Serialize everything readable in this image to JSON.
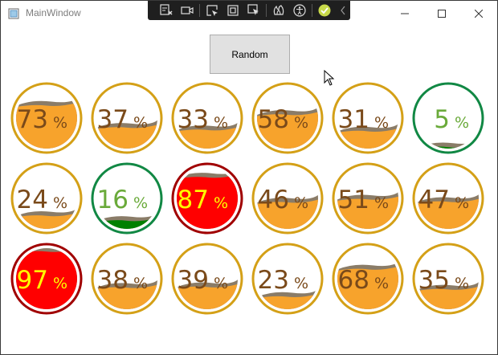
{
  "window": {
    "title": "MainWindow"
  },
  "toolbar": {
    "icons": [
      "live-visual-tree-icon",
      "record-icon",
      "select-element-icon",
      "display-layout-adorners-icon",
      "track-focus-icon",
      "hot-reload-icon",
      "accessibility-icon",
      "check-icon",
      "collapse-chevron-icon"
    ]
  },
  "controls": {
    "random_label": "Random"
  },
  "colors": {
    "normal_ring": "#d4a017",
    "normal_fill": "#f7a32c",
    "normal_text": "#7a4a1a",
    "low_ring": "#118844",
    "low_fill": "#008000",
    "low_text": "#6aaa3a",
    "high_ring": "#a00000",
    "high_fill": "#ff0000",
    "high_text": "#ffff00",
    "wave_shadow": "#8a7c68"
  },
  "gauges": [
    {
      "value": 73,
      "unit": "%",
      "state": "normal"
    },
    {
      "value": 37,
      "unit": "%",
      "state": "normal"
    },
    {
      "value": 33,
      "unit": "%",
      "state": "normal"
    },
    {
      "value": 58,
      "unit": "%",
      "state": "normal"
    },
    {
      "value": 31,
      "unit": "%",
      "state": "normal"
    },
    {
      "value": 5,
      "unit": "%",
      "state": "low"
    },
    {
      "value": 24,
      "unit": "%",
      "state": "normal"
    },
    {
      "value": 16,
      "unit": "%",
      "state": "low"
    },
    {
      "value": 87,
      "unit": "%",
      "state": "high"
    },
    {
      "value": 46,
      "unit": "%",
      "state": "normal"
    },
    {
      "value": 51,
      "unit": "%",
      "state": "normal"
    },
    {
      "value": 47,
      "unit": "%",
      "state": "normal"
    },
    {
      "value": 97,
      "unit": "%",
      "state": "high"
    },
    {
      "value": 38,
      "unit": "%",
      "state": "normal"
    },
    {
      "value": 39,
      "unit": "%",
      "state": "normal"
    },
    {
      "value": 23,
      "unit": "%",
      "state": "normal"
    },
    {
      "value": 68,
      "unit": "%",
      "state": "normal"
    },
    {
      "value": 35,
      "unit": "%",
      "state": "normal"
    }
  ]
}
